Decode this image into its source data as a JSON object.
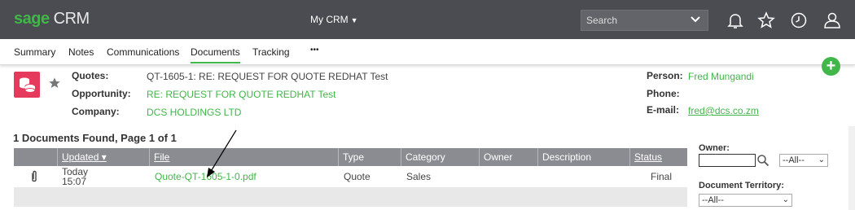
{
  "app": {
    "brand_primary": "sage",
    "brand_secondary": "CRM",
    "brand_color": "#41b649"
  },
  "topbar": {
    "menu_label": "My CRM",
    "search_placeholder": "Search"
  },
  "tabs": [
    {
      "label": "Summary"
    },
    {
      "label": "Notes"
    },
    {
      "label": "Communications"
    },
    {
      "label": "Documents",
      "active": true
    },
    {
      "label": "Tracking"
    },
    {
      "label": "•••"
    }
  ],
  "record": {
    "quotes_label": "Quotes:",
    "quotes_value": "QT-1605-1: RE: REQUEST FOR QUOTE REDHAT Test",
    "opportunity_label": "Opportunity:",
    "opportunity_value": "RE: REQUEST FOR QUOTE REDHAT  Test",
    "company_label": "Company:",
    "company_value": "DCS HOLDINGS LTD",
    "person_label": "Person:",
    "person_value": "Fred Mungandi",
    "phone_label": "Phone:",
    "phone_value": "",
    "email_label": "E-mail:",
    "email_value": "fred@dcs.co.zm"
  },
  "documents": {
    "found_text": "1 Documents Found, Page 1 of 1",
    "columns": [
      "Updated ▾",
      "File",
      "Type",
      "Category",
      "Owner",
      "Description",
      "Status"
    ],
    "rows": [
      {
        "updated_day": "Today",
        "updated_time": "15:07",
        "file": "Quote-QT-1605-1-0.pdf",
        "type": "Quote",
        "category": "Sales",
        "owner": "",
        "description": "",
        "status": "Final"
      }
    ]
  },
  "filters": {
    "owner_label": "Owner:",
    "owner_select": "--All--",
    "territory_label": "Document Territory:",
    "territory_select": "--All--"
  },
  "colors": {
    "accent": "#41b649",
    "topbar": "#4a4c51",
    "grid_header": "#8a8c91",
    "entity_icon": "#e53a5b"
  }
}
